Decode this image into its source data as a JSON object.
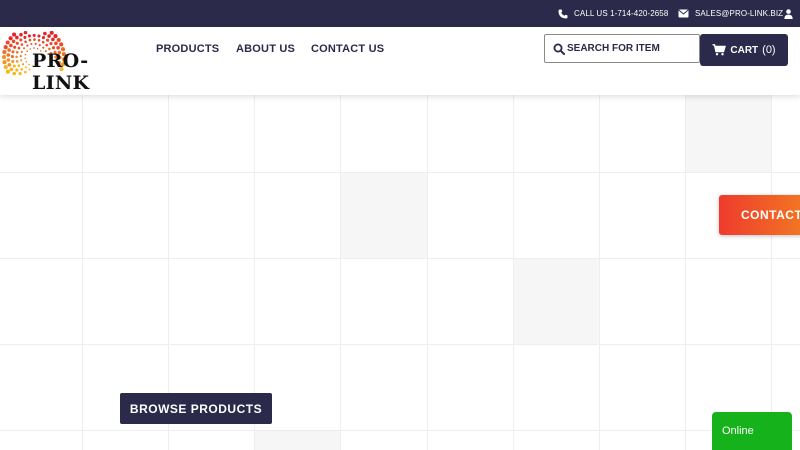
{
  "topbar": {
    "phone_label": "CALL US 1-714-420-2658",
    "email_label": "SALES@PRO-LINK.BIZ",
    "icons": [
      "phone-icon",
      "envelope-icon",
      "user-icon"
    ]
  },
  "header": {
    "logo_text": "PRO-LINK",
    "nav": {
      "products": "PRODUCTS",
      "about": "ABOUT US",
      "contact": "CONTACT US"
    },
    "search_label": "SEARCH FOR ITEM",
    "cart_label": "CART",
    "cart_count": "(0)"
  },
  "floating": {
    "contact_label": "CONTACT",
    "online_label": "Online"
  },
  "hero": {
    "browse_label": "BROWSE PRODUCTS"
  },
  "colors": {
    "navy": "#2b2a4a",
    "contact_gradient_start": "#ef3b2d",
    "contact_gradient_end": "#f27a22",
    "online_green": "#16b21b"
  }
}
